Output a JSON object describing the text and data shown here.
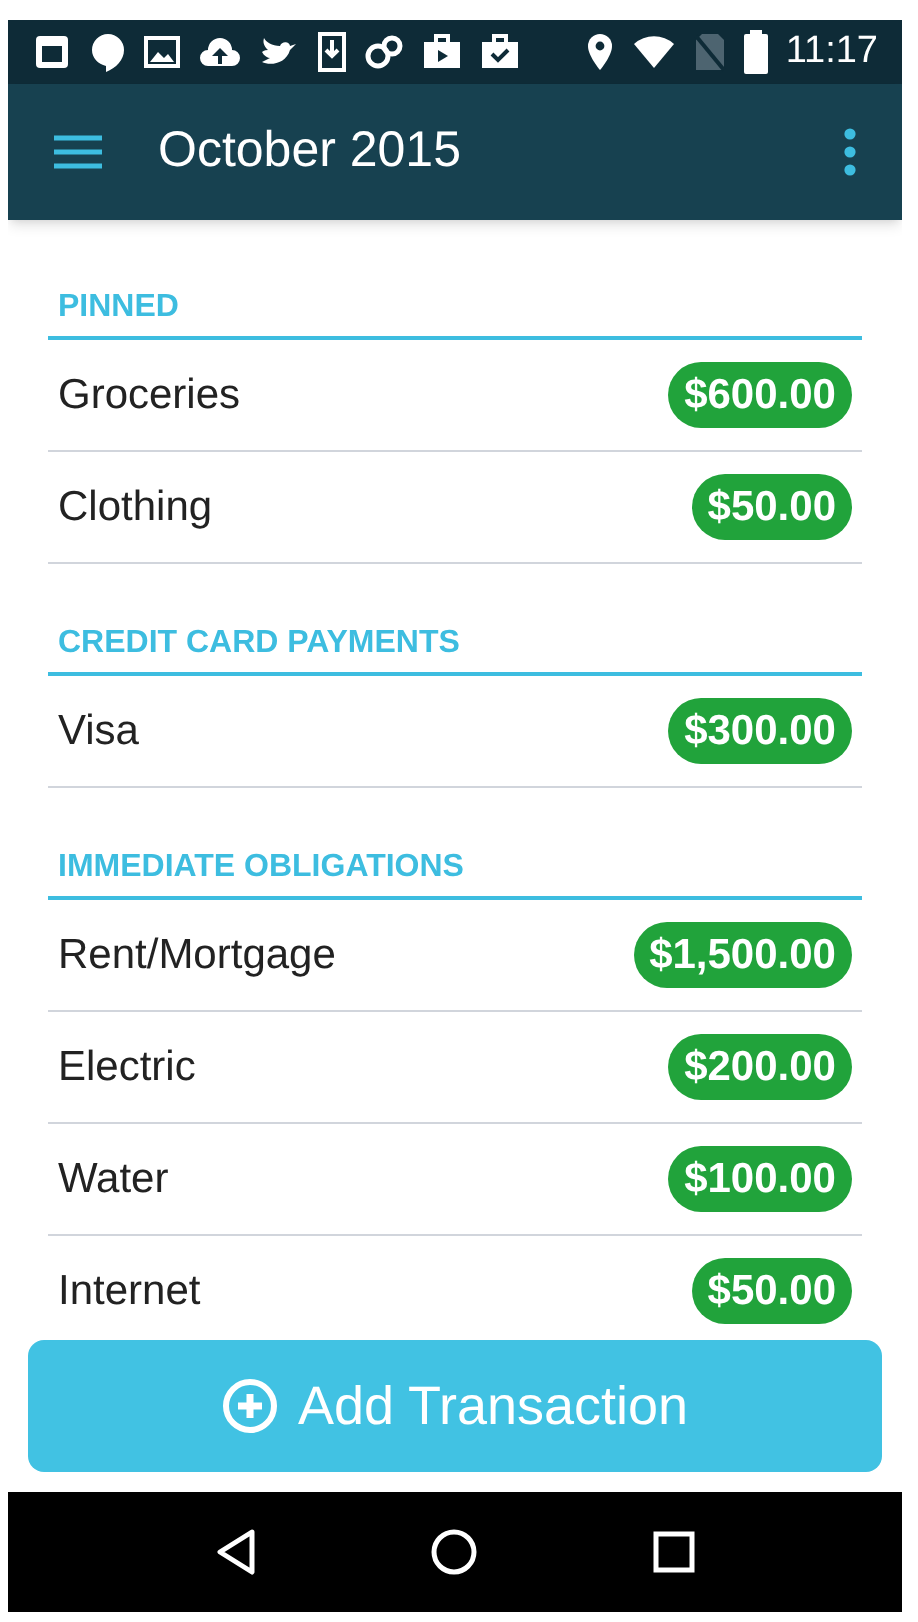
{
  "status_bar": {
    "time": "11:17"
  },
  "app_bar": {
    "title": "October 2015"
  },
  "sections": [
    {
      "title": "PINNED",
      "items": [
        {
          "name": "Groceries",
          "amount": "$600.00"
        },
        {
          "name": "Clothing",
          "amount": "$50.00"
        }
      ]
    },
    {
      "title": "CREDIT CARD PAYMENTS",
      "items": [
        {
          "name": "Visa",
          "amount": "$300.00"
        }
      ]
    },
    {
      "title": "IMMEDIATE OBLIGATIONS",
      "items": [
        {
          "name": "Rent/Mortgage",
          "amount": "$1,500.00"
        },
        {
          "name": "Electric",
          "amount": "$200.00"
        },
        {
          "name": "Water",
          "amount": "$100.00"
        },
        {
          "name": "Internet",
          "amount": "$50.00"
        }
      ]
    }
  ],
  "add_button": {
    "label": "Add Transaction"
  }
}
